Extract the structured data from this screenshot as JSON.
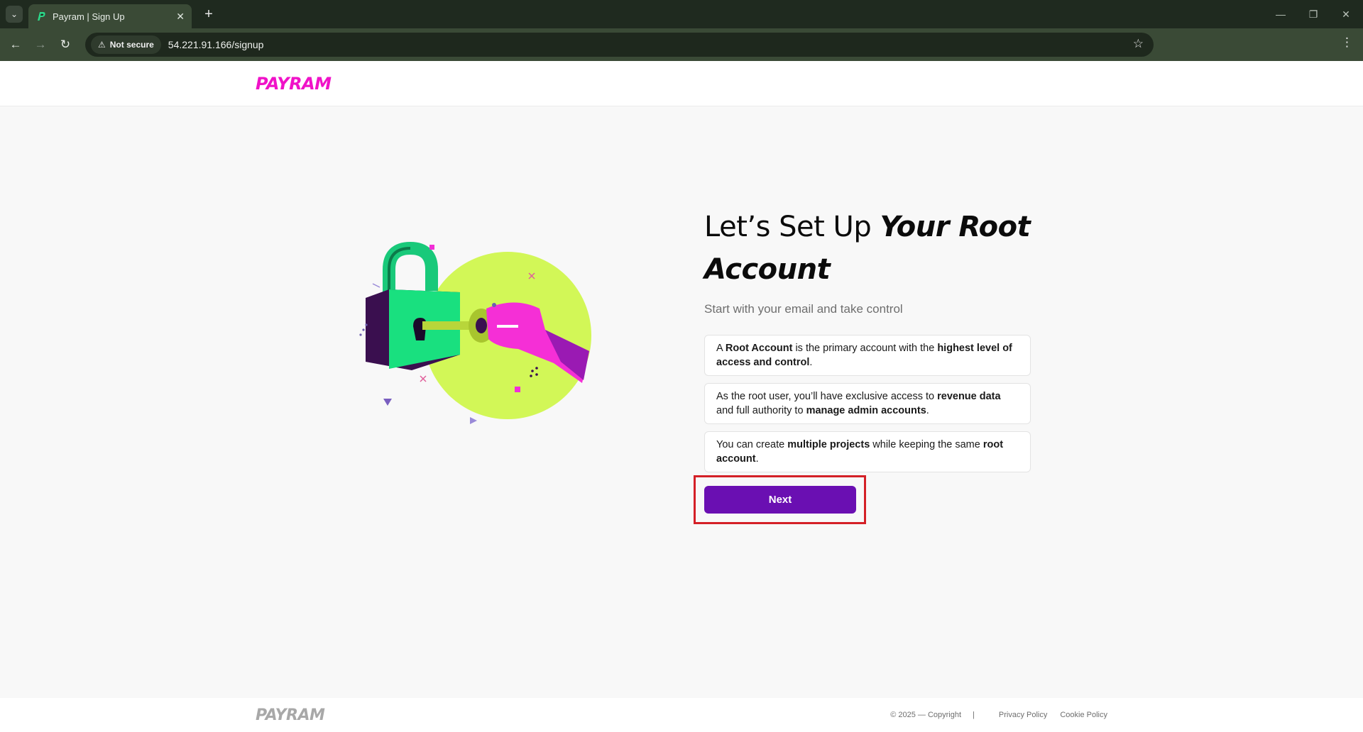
{
  "browser": {
    "tab_title": "Payram | Sign Up",
    "security_label": "Not secure",
    "url": "54.221.91.166/signup"
  },
  "header": {
    "logo_text": "PAYRAM"
  },
  "main": {
    "headline_plain": "Let’s Set Up ",
    "headline_emphasis": "Your Root Account",
    "subtitle": "Start with your email and take control",
    "cards": [
      {
        "parts": [
          "A ",
          "Root Account",
          " is the primary account with the ",
          "highest level of access and control",
          "."
        ]
      },
      {
        "parts": [
          "As the root user, you’ll have exclusive access to ",
          "revenue data",
          " and full authority to ",
          "manage admin accounts",
          "."
        ]
      },
      {
        "parts": [
          "You can create ",
          "multiple projects",
          " while keeping the same ",
          "root account",
          "."
        ]
      }
    ],
    "next_label": "Next"
  },
  "footer": {
    "logo_text": "PAYRAM",
    "copyright": "© 2025 — Copyright",
    "separator": "|",
    "privacy": "Privacy Policy",
    "cookie": "Cookie Policy"
  },
  "colors": {
    "brand": "#f012c8",
    "button": "#6a0fb2",
    "highlight": "#d42027"
  }
}
